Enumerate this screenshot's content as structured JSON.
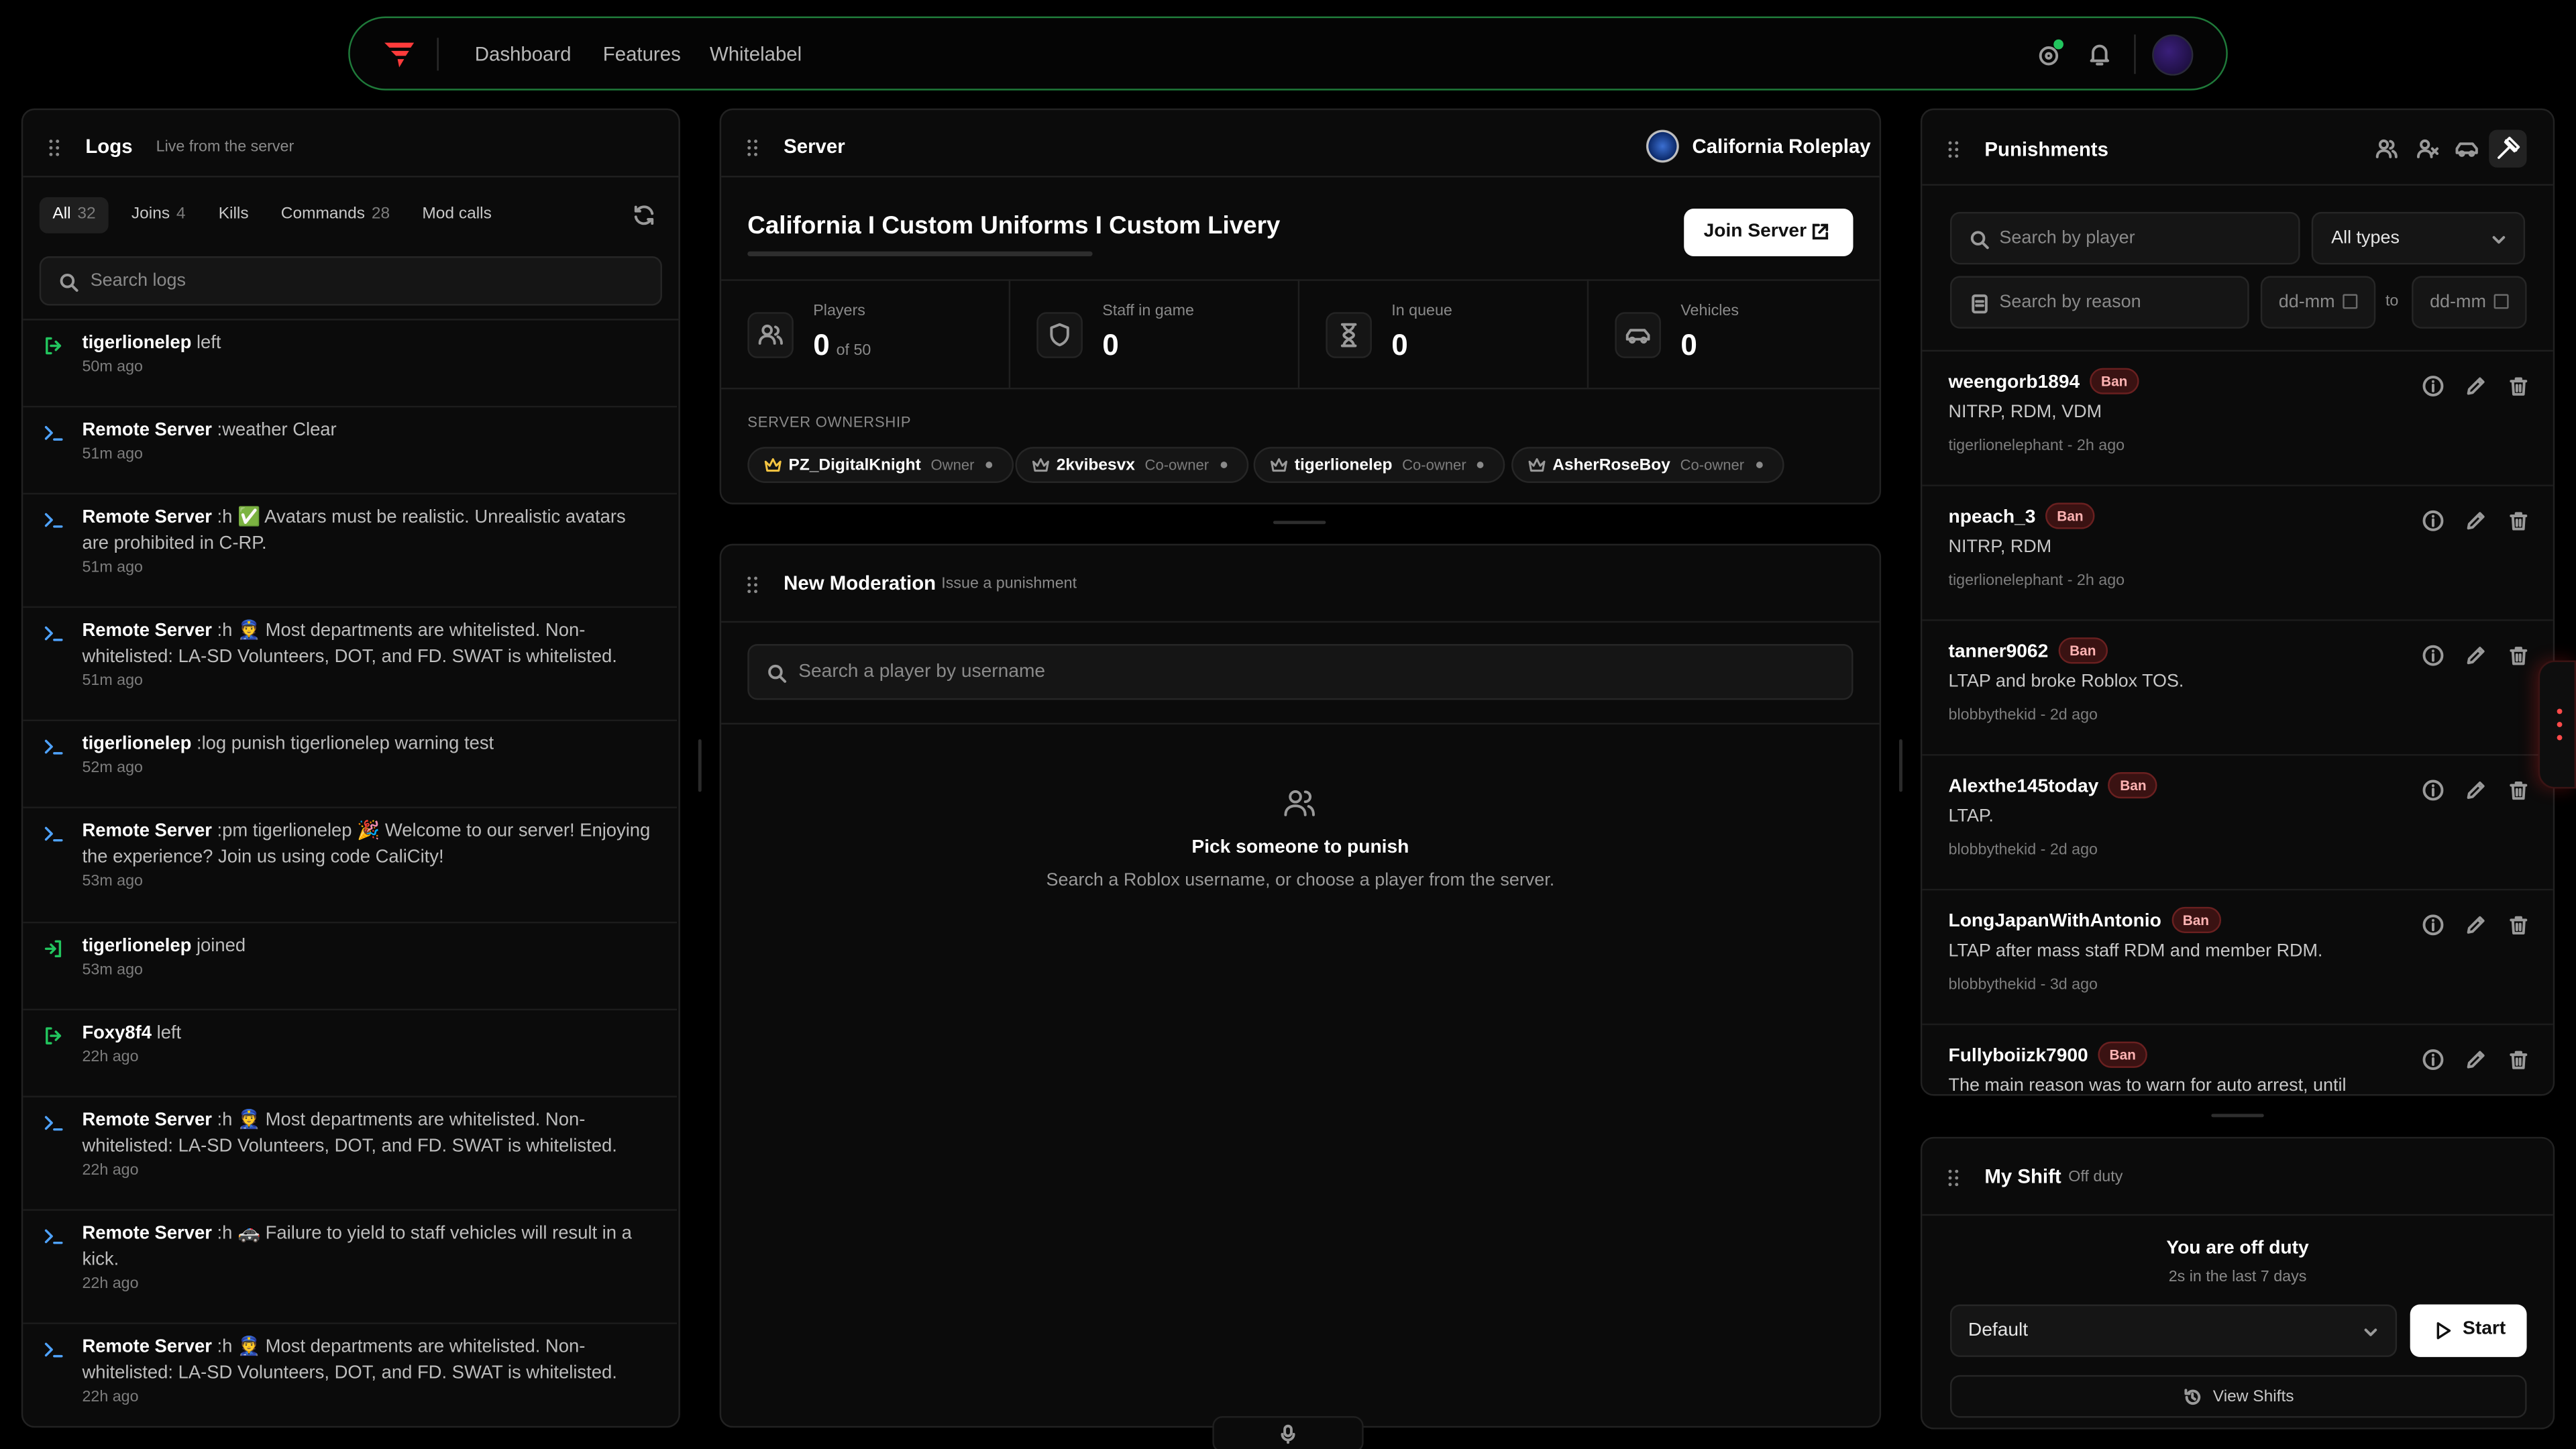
{
  "nav": {
    "links": [
      "Dashboard",
      "Features",
      "Whitelabel"
    ]
  },
  "logs": {
    "title": "Logs",
    "subtitle": "Live from the server",
    "tabs": [
      {
        "label": "All",
        "count": "32"
      },
      {
        "label": "Joins",
        "count": "4"
      },
      {
        "label": "Kills",
        "count": ""
      },
      {
        "label": "Commands",
        "count": "28"
      },
      {
        "label": "Mod calls",
        "count": ""
      }
    ],
    "search_placeholder": "Search logs",
    "entries": [
      {
        "icon": "leave-icon",
        "user": "tigerlionelep",
        "text": " left",
        "time": "50m ago"
      },
      {
        "icon": "terminal-icon",
        "user": "Remote Server",
        "text": " :weather Clear",
        "time": "51m ago"
      },
      {
        "icon": "terminal-icon",
        "user": "Remote Server",
        "text": " :h ✅ Avatars must be realistic. Unrealistic avatars are prohibited in C-RP.",
        "time": "51m ago"
      },
      {
        "icon": "terminal-icon",
        "user": "Remote Server",
        "text": " :h 👮 Most departments are whitelisted. Non-whitelisted: LA-SD Volunteers, DOT, and FD. SWAT is whitelisted.",
        "time": "51m ago"
      },
      {
        "icon": "terminal-icon",
        "user": "tigerlionelep",
        "text": " :log punish tigerlionelep warning test",
        "time": "52m ago"
      },
      {
        "icon": "terminal-icon",
        "user": "Remote Server",
        "text": " :pm tigerlionelep 🎉 Welcome to our server! Enjoying the experience? Join us using code CaliCity!",
        "time": "53m ago"
      },
      {
        "icon": "join-icon",
        "user": "tigerlionelep",
        "text": " joined",
        "time": "53m ago"
      },
      {
        "icon": "leave-icon",
        "user": "Foxy8f4",
        "text": " left",
        "time": "22h ago"
      },
      {
        "icon": "terminal-icon",
        "user": "Remote Server",
        "text": " :h 👮 Most departments are whitelisted. Non-whitelisted: LA-SD Volunteers, DOT, and FD. SWAT is whitelisted.",
        "time": "22h ago"
      },
      {
        "icon": "terminal-icon",
        "user": "Remote Server",
        "text": " :h 🚓 Failure to yield to staff vehicles will result in a kick.",
        "time": "22h ago"
      },
      {
        "icon": "terminal-icon",
        "user": "Remote Server",
        "text": " :h 👮 Most departments are whitelisted. Non-whitelisted: LA-SD Volunteers, DOT, and FD. SWAT is whitelisted.",
        "time": "22h ago"
      }
    ]
  },
  "server": {
    "title": "Server",
    "server_label": "California Roleplay",
    "name": "California I Custom Uniforms I Custom Livery",
    "join_label": "Join Server",
    "stats": [
      {
        "label": "Players",
        "value": "0",
        "extra": "of 50",
        "icon": "users-icon"
      },
      {
        "label": "Staff in game",
        "value": "0",
        "extra": "",
        "icon": "shield-icon"
      },
      {
        "label": "In queue",
        "value": "0",
        "extra": "",
        "icon": "hourglass-icon"
      },
      {
        "label": "Vehicles",
        "value": "0",
        "extra": "",
        "icon": "car-icon"
      }
    ],
    "ownership_label": "SERVER OWNERSHIP",
    "owners": [
      {
        "name": "PZ_DigitalKnight",
        "role": "Owner",
        "color": "#f5c542"
      },
      {
        "name": "2kvibesvx",
        "role": "Co-owner",
        "color": "#9a9a9a"
      },
      {
        "name": "tigerlionelep",
        "role": "Co-owner",
        "color": "#9a9a9a"
      },
      {
        "name": "AsherRoseBoy",
        "role": "Co-owner",
        "color": "#9a9a9a"
      }
    ]
  },
  "moderation": {
    "title": "New Moderation",
    "subtitle": "Issue a punishment",
    "search_placeholder": "Search a player by username",
    "empty_title": "Pick someone to punish",
    "empty_text": "Search a Roblox username, or choose a player from the server."
  },
  "punishments": {
    "title": "Punishments",
    "search_player_placeholder": "Search by player",
    "type_select": "All types",
    "search_reason_placeholder": "Search by reason",
    "date_from": "dd-mm",
    "date_sep": "to",
    "date_to": "dd-mm",
    "items": [
      {
        "user": "weengorb1894",
        "type": "Ban",
        "reason": "NITRP, RDM, VDM",
        "meta": "tigerlionelephant - 2h ago"
      },
      {
        "user": "npeach_3",
        "type": "Ban",
        "reason": "NITRP, RDM",
        "meta": "tigerlionelephant - 2h ago"
      },
      {
        "user": "tanner9062",
        "type": "Ban",
        "reason": "LTAP and broke Roblox TOS.",
        "meta": "blobbythekid - 2d ago"
      },
      {
        "user": "Alexthe145today",
        "type": "Ban",
        "reason": "LTAP.",
        "meta": "blobbythekid - 2d ago"
      },
      {
        "user": "LongJapanWithAntonio",
        "type": "Ban",
        "reason": "LTAP after mass staff RDM and member RDM.",
        "meta": "blobbythekid - 3d ago"
      },
      {
        "user": "Fullyboiizk7900",
        "type": "Ban",
        "reason": "The main reason was to warn for auto arrest, until",
        "meta": ""
      }
    ]
  },
  "shift": {
    "title": "My Shift",
    "status": "Off duty",
    "heading": "You are off duty",
    "sub": "2s in the last 7 days",
    "select": "Default",
    "start_label": "Start",
    "view_label": "View Shifts"
  },
  "colors": {
    "accent_green": "#22c55e",
    "brand_red": "#ff3b3b",
    "ban_red": "#ffb3b3"
  }
}
